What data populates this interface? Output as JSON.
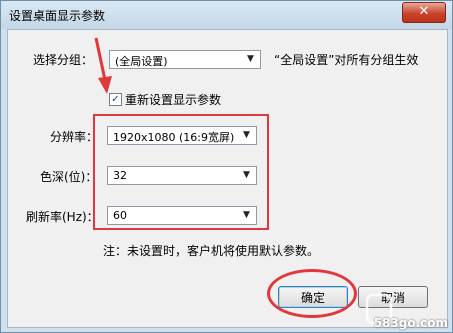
{
  "window": {
    "title": "设置桌面显示参数",
    "close_glyph": "✕"
  },
  "group": {
    "label": "选择分组：",
    "value": "(全局设置)",
    "note": "“全局设置”对所有分组生效"
  },
  "reset_checkbox": {
    "label": "重新设置显示参数",
    "checked": true
  },
  "resolution": {
    "label": "分辨率：",
    "value": "1920x1080 (16:9宽屏)"
  },
  "color_depth": {
    "label": "色深(位)：",
    "value": "32"
  },
  "refresh_rate": {
    "label": "刷新率(Hz)：",
    "value": "60"
  },
  "note": "注：未设置时，客户机将使用默认参数。",
  "buttons": {
    "ok": "确定",
    "cancel": "取消"
  },
  "watermark": {
    "text": "583go.com"
  },
  "colors": {
    "annotation_red": "#e0393d",
    "title_bg": "#c3d7e8"
  }
}
